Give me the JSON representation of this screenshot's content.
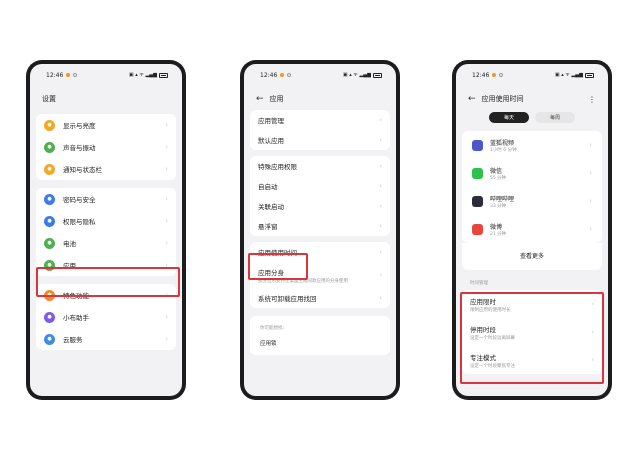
{
  "status": {
    "time": "12:46",
    "signal": "5G ᯤ ⁵ᴳ ᵃⁱˡ"
  },
  "phone1": {
    "title": "设置",
    "items": [
      {
        "label": "显示与亮度",
        "color": "#f5a623"
      },
      {
        "label": "声音与振动",
        "color": "#4caf50"
      },
      {
        "label": "通知与状态栏",
        "color": "#f5a623"
      },
      {
        "label": "密码与安全",
        "color": "#3d7bea"
      },
      {
        "label": "权限与隐私",
        "color": "#3d7bea"
      },
      {
        "label": "电池",
        "color": "#4caf50"
      },
      {
        "label": "应用",
        "color": "#4caf50"
      },
      {
        "label": "特色功能",
        "color": "#f58a23"
      },
      {
        "label": "小布助手",
        "color": "#7b5cea"
      },
      {
        "label": "云服务",
        "color": "#3d8bea"
      }
    ]
  },
  "phone2": {
    "title": "应用",
    "items": [
      "应用管理",
      "默认应用",
      "特殊应用权限",
      "自启动",
      "关联启动",
      "悬浮窗",
      "应用使用时间"
    ],
    "clone": {
      "label": "应用分身",
      "sub": "部分应用支持在桌面生成同款应用的分身使用"
    },
    "uninstall": "系统可卸载应用找回",
    "search_hint": "你可能想找:",
    "lock": "应用锁"
  },
  "phone3": {
    "title": "应用使用时间",
    "tabs": {
      "day": "每天",
      "week": "每周"
    },
    "apps": [
      {
        "name": "蓝狐视频",
        "time": "1小时 6 分钟",
        "color": "#4a56c9"
      },
      {
        "name": "微信",
        "time": "55 分钟",
        "color": "#2ec24a"
      },
      {
        "name": "哔哩哔哩",
        "time": "33 分钟",
        "color": "#2c2c3a"
      },
      {
        "name": "微博",
        "time": "21 分钟",
        "color": "#e8453c"
      }
    ],
    "more": "查看更多",
    "section": "时间管理",
    "features": [
      {
        "label": "应用限时",
        "sub": "限制应用的使用时长"
      },
      {
        "label": "停用时段",
        "sub": "设定一个时段远离屏幕"
      },
      {
        "label": "专注模式",
        "sub": "设定一个时段聚焦专注"
      }
    ]
  },
  "colors": {
    "highlight": "#d9353f"
  }
}
